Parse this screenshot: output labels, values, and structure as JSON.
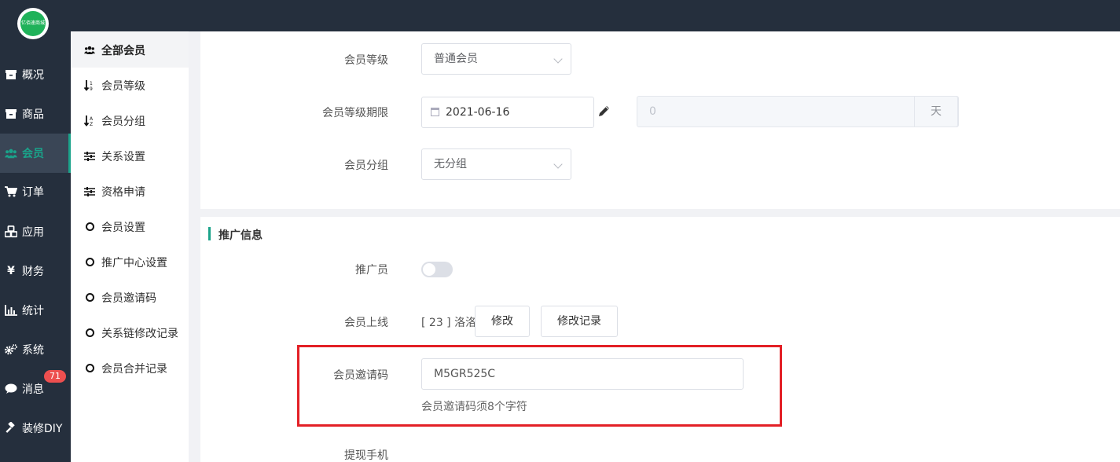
{
  "logo": {
    "text": "亿佰速商城"
  },
  "nav": {
    "items": [
      {
        "label": "概况",
        "icon": "archive-icon"
      },
      {
        "label": "商品",
        "icon": "archive-icon"
      },
      {
        "label": "会员",
        "icon": "users-icon",
        "active": true
      },
      {
        "label": "订单",
        "icon": "cart-icon"
      },
      {
        "label": "应用",
        "icon": "cubes-icon"
      },
      {
        "label": "财务",
        "icon": "yen-icon"
      },
      {
        "label": "统计",
        "icon": "bar-chart-icon"
      },
      {
        "label": "系统",
        "icon": "gears-icon"
      },
      {
        "label": "消息",
        "icon": "comment-icon",
        "badge": "71"
      },
      {
        "label": "装修DIY",
        "icon": "gavel-icon"
      }
    ]
  },
  "subnav": {
    "items": [
      {
        "label": "全部会员",
        "icon": "users-icon",
        "active": true
      },
      {
        "label": "会员等级",
        "icon": "sort-numeric-icon"
      },
      {
        "label": "会员分组",
        "icon": "sort-alpha-icon"
      },
      {
        "label": "关系设置",
        "icon": "sliders-icon"
      },
      {
        "label": "资格申请",
        "icon": "sliders-icon"
      },
      {
        "label": "会员设置",
        "icon": "circle-icon"
      },
      {
        "label": "推广中心设置",
        "icon": "circle-icon"
      },
      {
        "label": "会员邀请码",
        "icon": "circle-icon"
      },
      {
        "label": "关系链修改记录",
        "icon": "circle-icon"
      },
      {
        "label": "会员合并记录",
        "icon": "circle-icon"
      }
    ]
  },
  "form": {
    "level_label": "会员等级",
    "level_value": "普通会员",
    "expire_label": "会员等级期限",
    "expire_date": "2021-06-16",
    "expire_days": "0",
    "expire_unit": "天",
    "group_label": "会员分组",
    "group_value": "无分组"
  },
  "promo": {
    "title": "推广信息",
    "promoter_label": "推广员",
    "promoter_enabled": false,
    "upline_label": "会员上线",
    "upline_value": "[ 23 ] 洛洛",
    "edit_button": "修改",
    "history_button": "修改记录",
    "invite_label": "会员邀请码",
    "invite_value": "M5GR525C",
    "invite_hint": "会员邀请码须8个字符",
    "phone_label": "提现手机"
  },
  "colors": {
    "nav_bg": "#252f3d",
    "accent": "#1aa38a",
    "badge": "#ed4f4f",
    "highlight": "#e32026"
  }
}
